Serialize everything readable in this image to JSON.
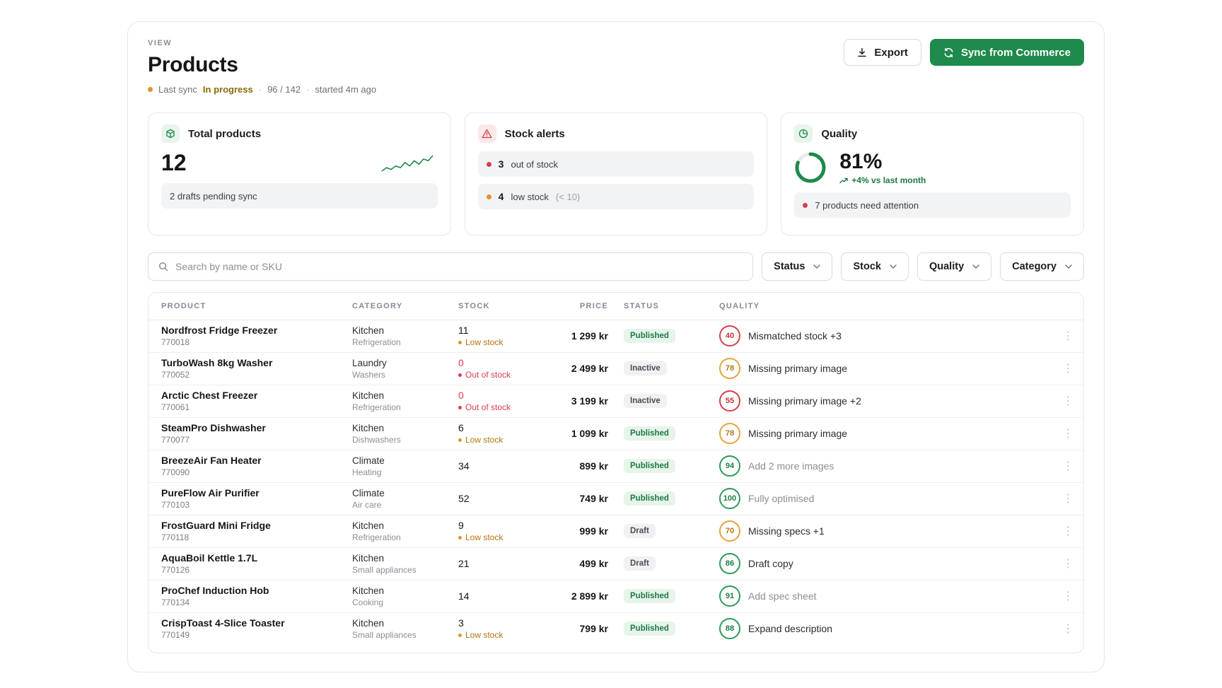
{
  "header": {
    "view_label": "VIEW",
    "title": "Products",
    "sync_label": "Last sync",
    "sync_status": "In progress",
    "sync_progress": "96 / 142",
    "sync_started": "started 4m ago"
  },
  "actions": {
    "export_label": "Export",
    "sync_label": "Sync from Commerce"
  },
  "cards": {
    "total": {
      "title": "Total products",
      "value": "12",
      "pill": "2 drafts pending sync",
      "sparkline": [
        3,
        5,
        4,
        6,
        5,
        8,
        6,
        9,
        7,
        10,
        9,
        12
      ]
    },
    "alerts": {
      "title": "Stock alerts",
      "out_count": "3",
      "out_label": "out of stock",
      "low_count": "4",
      "low_label": "low stock",
      "low_threshold": "(< 10)"
    },
    "quality": {
      "title": "Quality",
      "percent": "81%",
      "percent_value": 81,
      "delta": "+4% vs last month",
      "pill": "7 products need attention"
    }
  },
  "search": {
    "placeholder": "Search by name or SKU"
  },
  "filters": [
    "Status",
    "Stock",
    "Quality",
    "Category"
  ],
  "table": {
    "columns": [
      "PRODUCT",
      "CATEGORY",
      "STOCK",
      "PRICE",
      "STATUS",
      "QUALITY"
    ],
    "rows": [
      {
        "name": "Nordfrost Fridge Freezer",
        "sku": "770018",
        "cat": "Kitchen",
        "sub": "Refrigeration",
        "stock": "11",
        "stock_note": "Low stock",
        "stock_state": "low",
        "price": "1 299 kr",
        "status": "Published",
        "score": "40",
        "score_tone": "red",
        "quality": "Mismatched stock +3",
        "faded": false
      },
      {
        "name": "TurboWash 8kg Washer",
        "sku": "770052",
        "cat": "Laundry",
        "sub": "Washers",
        "stock": "0",
        "stock_note": "Out of stock",
        "stock_state": "out",
        "price": "2 499 kr",
        "status": "Inactive",
        "score": "78",
        "score_tone": "orange",
        "quality": "Missing primary image",
        "faded": false
      },
      {
        "name": "Arctic Chest Freezer",
        "sku": "770061",
        "cat": "Kitchen",
        "sub": "Refrigeration",
        "stock": "0",
        "stock_note": "Out of stock",
        "stock_state": "out",
        "price": "3 199 kr",
        "status": "Inactive",
        "score": "55",
        "score_tone": "red",
        "quality": "Missing primary image +2",
        "faded": false
      },
      {
        "name": "SteamPro Dishwasher",
        "sku": "770077",
        "cat": "Kitchen",
        "sub": "Dishwashers",
        "stock": "6",
        "stock_note": "Low stock",
        "stock_state": "low",
        "price": "1 099 kr",
        "status": "Published",
        "score": "78",
        "score_tone": "orange",
        "quality": "Missing primary image",
        "faded": false
      },
      {
        "name": "BreezeAir Fan Heater",
        "sku": "770090",
        "cat": "Climate",
        "sub": "Heating",
        "stock": "34",
        "stock_note": "",
        "stock_state": "ok",
        "price": "899 kr",
        "status": "Published",
        "score": "94",
        "score_tone": "green",
        "quality": "Add 2 more images",
        "faded": true
      },
      {
        "name": "PureFlow Air Purifier",
        "sku": "770103",
        "cat": "Climate",
        "sub": "Air care",
        "stock": "52",
        "stock_note": "",
        "stock_state": "ok",
        "price": "749 kr",
        "status": "Published",
        "score": "100",
        "score_tone": "green",
        "quality": "Fully optimised",
        "faded": true
      },
      {
        "name": "FrostGuard Mini Fridge",
        "sku": "770118",
        "cat": "Kitchen",
        "sub": "Refrigeration",
        "stock": "9",
        "stock_note": "Low stock",
        "stock_state": "low",
        "price": "999 kr",
        "status": "Draft",
        "score": "70",
        "score_tone": "orange",
        "quality": "Missing specs +1",
        "faded": false
      },
      {
        "name": "AquaBoil Kettle 1.7L",
        "sku": "770126",
        "cat": "Kitchen",
        "sub": "Small appliances",
        "stock": "21",
        "stock_note": "",
        "stock_state": "ok",
        "price": "499 kr",
        "status": "Draft",
        "score": "86",
        "score_tone": "green",
        "quality": "Draft copy",
        "faded": false
      },
      {
        "name": "ProChef Induction Hob",
        "sku": "770134",
        "cat": "Kitchen",
        "sub": "Cooking",
        "stock": "14",
        "stock_note": "",
        "stock_state": "ok",
        "price": "2 899 kr",
        "status": "Published",
        "score": "91",
        "score_tone": "green",
        "quality": "Add spec sheet",
        "faded": true
      },
      {
        "name": "CrispToast 4-Slice Toaster",
        "sku": "770149",
        "cat": "Kitchen",
        "sub": "Small appliances",
        "stock": "3",
        "stock_note": "Low stock",
        "stock_state": "low",
        "price": "799 kr",
        "status": "Published",
        "score": "88",
        "score_tone": "green",
        "quality": "Expand description",
        "faded": false
      }
    ]
  },
  "colors": {
    "brand_green": "#1e8a4b",
    "alert_red": "#d93f4a",
    "warn_orange": "#e7912e"
  }
}
